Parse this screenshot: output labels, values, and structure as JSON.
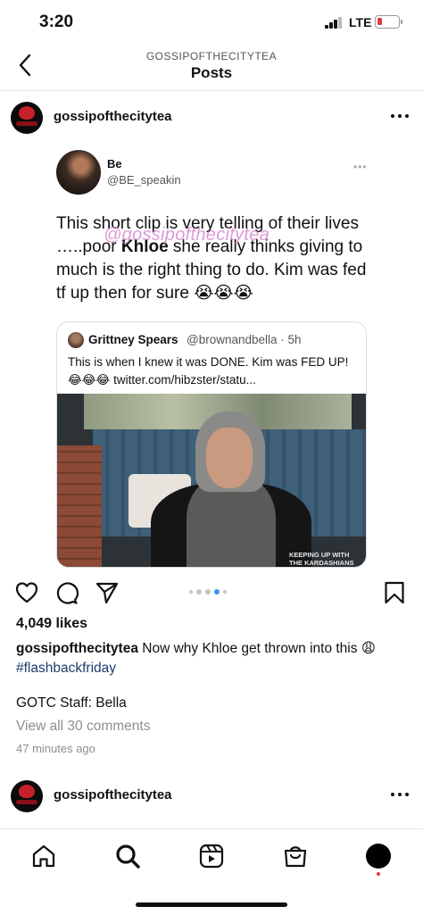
{
  "status": {
    "time": "3:20",
    "network": "LTE",
    "battery_color": "#e5383b"
  },
  "header": {
    "account": "GOSSIPOFTHECITYTEA",
    "title": "Posts"
  },
  "post": {
    "username": "gossipofthecitytea",
    "tweet": {
      "name": "Be",
      "handle": "@BE_speakin",
      "menu": "•••",
      "text_before": "This short clip is very telling of their lives …..poor ",
      "text_bold": "Khloe",
      "text_after": " she really thinks giving to much is the right thing to do. Kim was fed tf up then for sure 😭😭😭",
      "watermark": "@gossipofthecitytea",
      "quote": {
        "name": "Grittney Spears",
        "meta": "@brownandbella · 5h",
        "text": "This is when I knew it was DONE. Kim was FED UP! 😂😂😂 twitter.com/hibzster/statu...",
        "video_caption": "KEEPING UP WITH THE KARDASHIANS"
      }
    },
    "carousel": {
      "count": 5,
      "active_index": 3
    },
    "likes": "4,049 likes",
    "caption_user": "gossipofthecitytea",
    "caption_text": " Now why Khloe get thrown into this 😩",
    "hashtag": "#flashbackfriday",
    "staff": "GOTC Staff: Bella",
    "view_comments": "View all 30 comments",
    "time_ago": "47 minutes ago"
  },
  "next_post": {
    "username": "gossipofthecitytea"
  },
  "tab_bar": {
    "items": [
      "home-icon",
      "search-icon",
      "reels-icon",
      "shop-icon",
      "profile-avatar"
    ],
    "active": "search-icon"
  }
}
